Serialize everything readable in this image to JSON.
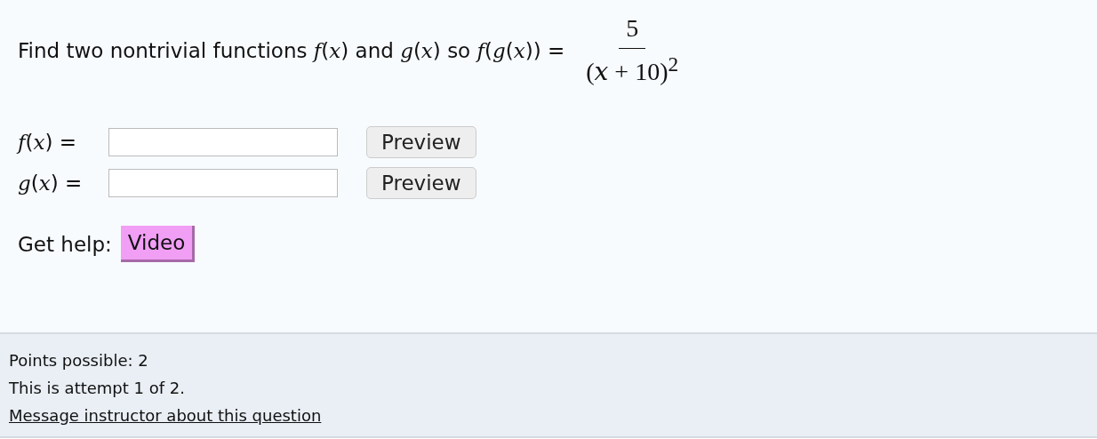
{
  "question": {
    "prompt": "Find two nontrivial functions *f*(*x*) and *g*(*x*) so *f*(*g*(*x*)) =",
    "fraction": {
      "numerator": "5",
      "denominator": "(*x* + 10)$^{2}$"
    }
  },
  "answers": [
    {
      "label": "*f*(*x*) =",
      "button": "Preview"
    },
    {
      "label": "*g*(*x*) =",
      "button": "Preview"
    }
  ],
  "help": {
    "label": "Get help:",
    "button": "Video"
  },
  "footer": {
    "points": "Points possible: 2",
    "attempt": "This is attempt 1 of 2.",
    "link": "Message instructor about this question"
  }
}
